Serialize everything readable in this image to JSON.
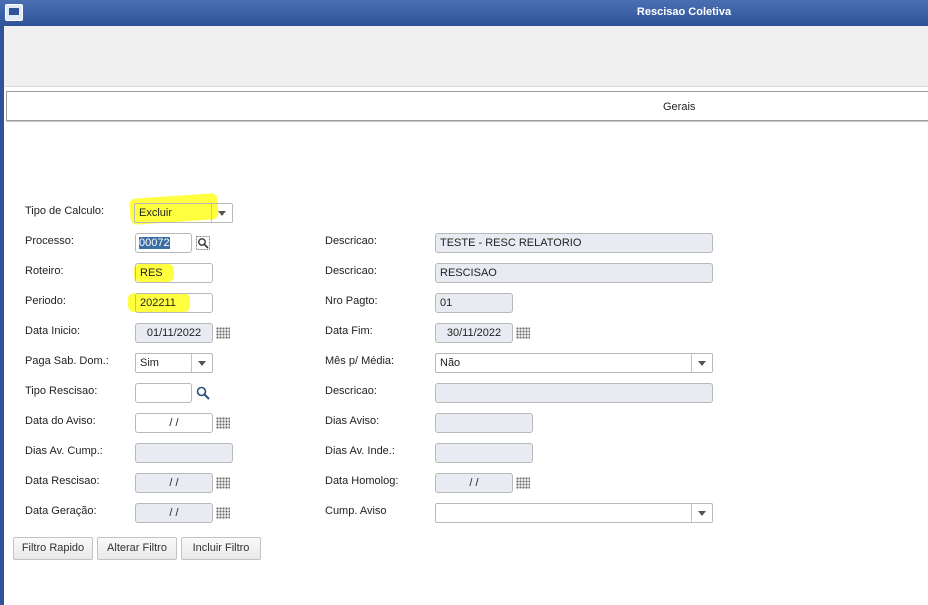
{
  "window": {
    "title": "Rescisao Coletiva"
  },
  "tabs": [
    {
      "label": "Gerais"
    }
  ],
  "form": {
    "tipo_calculo": {
      "label": "Tipo de Calculo:",
      "value": "Excluir"
    },
    "processo": {
      "label": "Processo:",
      "value": "00072"
    },
    "processo_descricao": {
      "label": "Descricao:",
      "value": "TESTE - RESC RELATORIO"
    },
    "roteiro": {
      "label": "Roteiro:",
      "value": "RES"
    },
    "roteiro_descricao": {
      "label": "Descricao:",
      "value": "RESCISAO"
    },
    "periodo": {
      "label": "Periodo:",
      "value": "202211"
    },
    "nro_pagto": {
      "label": "Nro Pagto:",
      "value": "01"
    },
    "data_inicio": {
      "label": "Data Inicio:",
      "value": "01/11/2022"
    },
    "data_fim": {
      "label": "Data Fim:",
      "value": "30/11/2022"
    },
    "paga_sab_dom": {
      "label": "Paga Sab. Dom.:",
      "value": "Sim"
    },
    "mes_media": {
      "label": "Mês p/ Média:",
      "value": "Não"
    },
    "tipo_rescisao": {
      "label": "Tipo Rescisao:",
      "value": ""
    },
    "rescisao_descricao": {
      "label": "Descricao:",
      "value": ""
    },
    "data_aviso": {
      "label": "Data do Aviso:",
      "value": " /  / "
    },
    "dias_aviso": {
      "label": "Dias Aviso:",
      "value": ""
    },
    "dias_av_cump": {
      "label": "Dias Av. Cump.:",
      "value": ""
    },
    "dias_av_inde": {
      "label": "Dias Av. Inde.:",
      "value": ""
    },
    "data_rescisao": {
      "label": "Data Rescisao:",
      "value": " /  / "
    },
    "data_homolog": {
      "label": "Data Homolog:",
      "value": " /  / "
    },
    "data_geracao": {
      "label": "Data Geração:",
      "value": " /  / "
    },
    "cump_aviso": {
      "label": "Cump. Aviso",
      "value": ""
    }
  },
  "buttons": {
    "filtro_rapido": "Filtro Rapido",
    "alterar_filtro": "Alterar Filtro",
    "incluir_filtro": "Incluir Filtro"
  },
  "colors": {
    "titlebar": "#2f5398",
    "highlight": "#ffff00",
    "field_bg": "#e8ebf1"
  },
  "icons": [
    "app-icon",
    "dropdown-arrow-icon",
    "lookup-icon",
    "search-icon",
    "calendar-icon"
  ]
}
